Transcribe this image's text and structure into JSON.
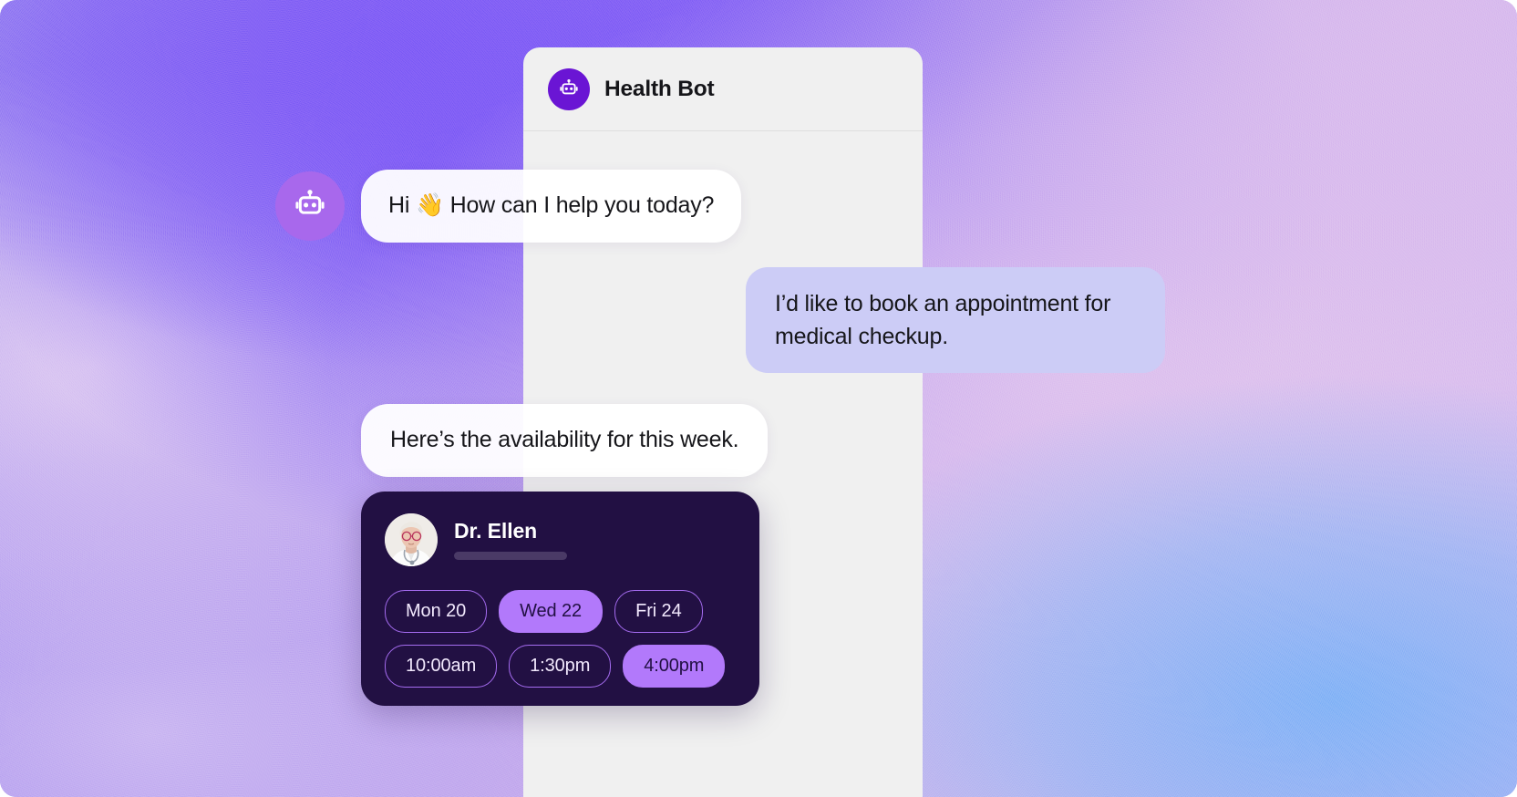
{
  "header": {
    "title": "Health Bot",
    "avatar_icon": "robot-icon",
    "avatar_color": "#6A15D4"
  },
  "theme": {
    "panel_bg": "#F0F0F0",
    "user_bubble": "#CCCCF6",
    "bot_bubble": "#FFFFFF",
    "card_bg": "#221043",
    "accent": "#B279FB",
    "accent_outline": "#A56CF0",
    "bot_avatar_bubble": "#A868EC"
  },
  "messages": [
    {
      "id": "m1",
      "sender": "bot",
      "text": "Hi 👋 How can I help you today?",
      "avatar_icon": "robot-icon"
    },
    {
      "id": "m2",
      "sender": "user",
      "text": "I’d like to book an appointment for medical checkup."
    },
    {
      "id": "m3",
      "sender": "bot",
      "text": "Here’s the availability for this week."
    }
  ],
  "doctor_card": {
    "name": "Dr. Ellen",
    "avatar_icon": "doctor-photo-avatar",
    "dates": [
      {
        "label": "Mon 20",
        "selected": false
      },
      {
        "label": "Wed 22",
        "selected": true
      },
      {
        "label": "Fri 24",
        "selected": false
      }
    ],
    "times": [
      {
        "label": "10:00am",
        "selected": false
      },
      {
        "label": "1:30pm",
        "selected": false
      },
      {
        "label": "4:00pm",
        "selected": true
      }
    ]
  }
}
